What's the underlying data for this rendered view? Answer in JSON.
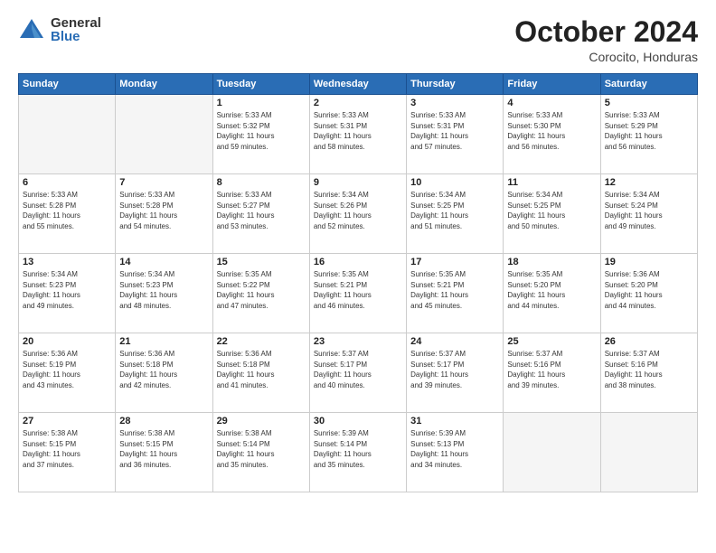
{
  "header": {
    "logo_general": "General",
    "logo_blue": "Blue",
    "title": "October 2024",
    "location": "Corocito, Honduras"
  },
  "days_of_week": [
    "Sunday",
    "Monday",
    "Tuesday",
    "Wednesday",
    "Thursday",
    "Friday",
    "Saturday"
  ],
  "weeks": [
    [
      {
        "day": "",
        "empty": true
      },
      {
        "day": "",
        "empty": true
      },
      {
        "day": "1",
        "sunrise": "5:33 AM",
        "sunset": "5:32 PM",
        "daylight": "11 hours and 59 minutes."
      },
      {
        "day": "2",
        "sunrise": "5:33 AM",
        "sunset": "5:31 PM",
        "daylight": "11 hours and 58 minutes."
      },
      {
        "day": "3",
        "sunrise": "5:33 AM",
        "sunset": "5:31 PM",
        "daylight": "11 hours and 57 minutes."
      },
      {
        "day": "4",
        "sunrise": "5:33 AM",
        "sunset": "5:30 PM",
        "daylight": "11 hours and 56 minutes."
      },
      {
        "day": "5",
        "sunrise": "5:33 AM",
        "sunset": "5:29 PM",
        "daylight": "11 hours and 56 minutes."
      }
    ],
    [
      {
        "day": "6",
        "sunrise": "5:33 AM",
        "sunset": "5:28 PM",
        "daylight": "11 hours and 55 minutes."
      },
      {
        "day": "7",
        "sunrise": "5:33 AM",
        "sunset": "5:28 PM",
        "daylight": "11 hours and 54 minutes."
      },
      {
        "day": "8",
        "sunrise": "5:33 AM",
        "sunset": "5:27 PM",
        "daylight": "11 hours and 53 minutes."
      },
      {
        "day": "9",
        "sunrise": "5:34 AM",
        "sunset": "5:26 PM",
        "daylight": "11 hours and 52 minutes."
      },
      {
        "day": "10",
        "sunrise": "5:34 AM",
        "sunset": "5:25 PM",
        "daylight": "11 hours and 51 minutes."
      },
      {
        "day": "11",
        "sunrise": "5:34 AM",
        "sunset": "5:25 PM",
        "daylight": "11 hours and 50 minutes."
      },
      {
        "day": "12",
        "sunrise": "5:34 AM",
        "sunset": "5:24 PM",
        "daylight": "11 hours and 49 minutes."
      }
    ],
    [
      {
        "day": "13",
        "sunrise": "5:34 AM",
        "sunset": "5:23 PM",
        "daylight": "11 hours and 49 minutes."
      },
      {
        "day": "14",
        "sunrise": "5:34 AM",
        "sunset": "5:23 PM",
        "daylight": "11 hours and 48 minutes."
      },
      {
        "day": "15",
        "sunrise": "5:35 AM",
        "sunset": "5:22 PM",
        "daylight": "11 hours and 47 minutes."
      },
      {
        "day": "16",
        "sunrise": "5:35 AM",
        "sunset": "5:21 PM",
        "daylight": "11 hours and 46 minutes."
      },
      {
        "day": "17",
        "sunrise": "5:35 AM",
        "sunset": "5:21 PM",
        "daylight": "11 hours and 45 minutes."
      },
      {
        "day": "18",
        "sunrise": "5:35 AM",
        "sunset": "5:20 PM",
        "daylight": "11 hours and 44 minutes."
      },
      {
        "day": "19",
        "sunrise": "5:36 AM",
        "sunset": "5:20 PM",
        "daylight": "11 hours and 44 minutes."
      }
    ],
    [
      {
        "day": "20",
        "sunrise": "5:36 AM",
        "sunset": "5:19 PM",
        "daylight": "11 hours and 43 minutes."
      },
      {
        "day": "21",
        "sunrise": "5:36 AM",
        "sunset": "5:18 PM",
        "daylight": "11 hours and 42 minutes."
      },
      {
        "day": "22",
        "sunrise": "5:36 AM",
        "sunset": "5:18 PM",
        "daylight": "11 hours and 41 minutes."
      },
      {
        "day": "23",
        "sunrise": "5:37 AM",
        "sunset": "5:17 PM",
        "daylight": "11 hours and 40 minutes."
      },
      {
        "day": "24",
        "sunrise": "5:37 AM",
        "sunset": "5:17 PM",
        "daylight": "11 hours and 39 minutes."
      },
      {
        "day": "25",
        "sunrise": "5:37 AM",
        "sunset": "5:16 PM",
        "daylight": "11 hours and 39 minutes."
      },
      {
        "day": "26",
        "sunrise": "5:37 AM",
        "sunset": "5:16 PM",
        "daylight": "11 hours and 38 minutes."
      }
    ],
    [
      {
        "day": "27",
        "sunrise": "5:38 AM",
        "sunset": "5:15 PM",
        "daylight": "11 hours and 37 minutes."
      },
      {
        "day": "28",
        "sunrise": "5:38 AM",
        "sunset": "5:15 PM",
        "daylight": "11 hours and 36 minutes."
      },
      {
        "day": "29",
        "sunrise": "5:38 AM",
        "sunset": "5:14 PM",
        "daylight": "11 hours and 35 minutes."
      },
      {
        "day": "30",
        "sunrise": "5:39 AM",
        "sunset": "5:14 PM",
        "daylight": "11 hours and 35 minutes."
      },
      {
        "day": "31",
        "sunrise": "5:39 AM",
        "sunset": "5:13 PM",
        "daylight": "11 hours and 34 minutes."
      },
      {
        "day": "",
        "empty": true
      },
      {
        "day": "",
        "empty": true
      }
    ]
  ]
}
